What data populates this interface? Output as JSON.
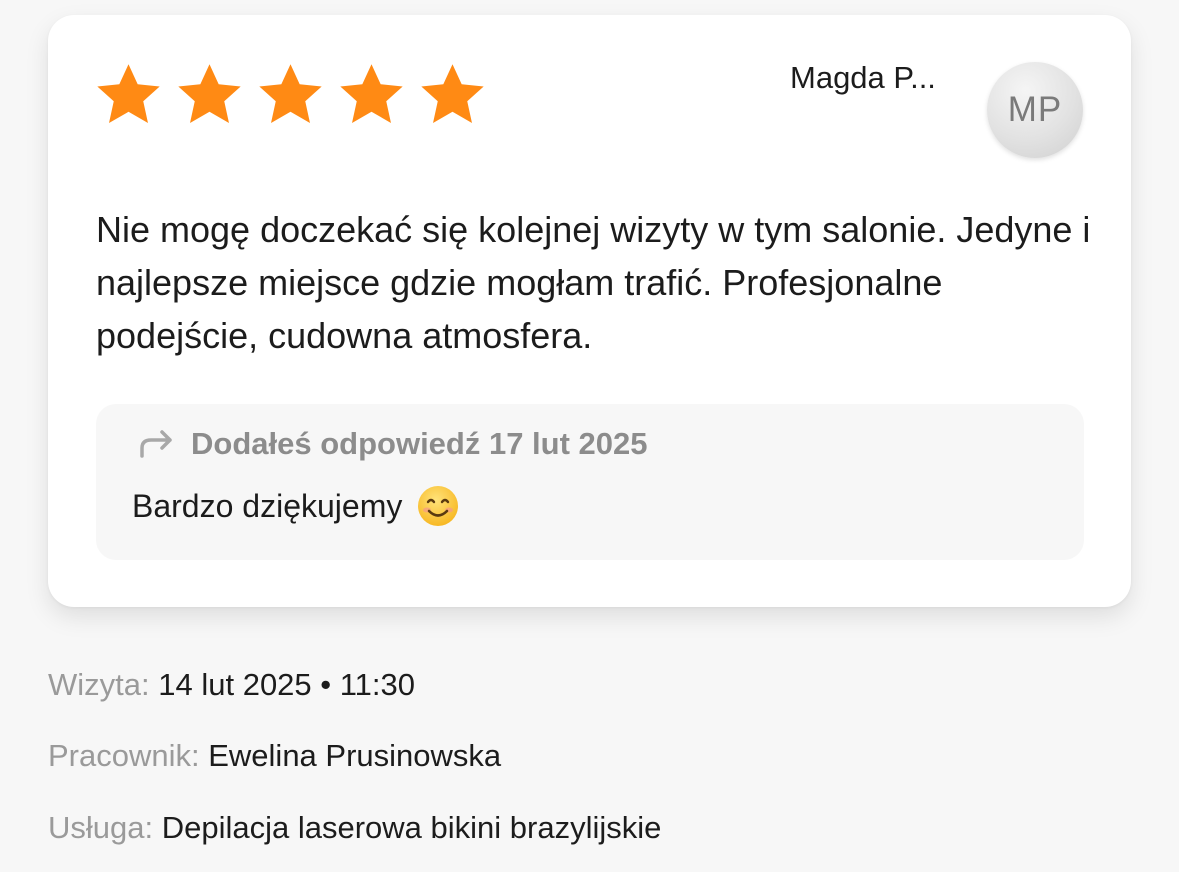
{
  "review": {
    "rating": 5,
    "max_rating": 5,
    "author_name": "Magda P...",
    "author_initials": "MP",
    "text": "Nie mogę doczekać się kolejnej wizyty w tym salonie. Jedyne i najlepsze miejsce gdzie mogłam trafić. Profesjonalne podejście, cudowna atmosfera.",
    "star_color": "#ff8a14"
  },
  "reply": {
    "header": "Dodałeś odpowiedź 17 lut 2025",
    "text": "Bardzo dziękujemy",
    "icon": "reply-arrow-icon",
    "emoji": "smiling-face-icon"
  },
  "details": {
    "visit_label": "Wizyta:",
    "visit_value": "14 lut 2025 • 11:30",
    "employee_label": "Pracownik:",
    "employee_value": "Ewelina Prusinowska",
    "service_label": "Usługa:",
    "service_value": "Depilacja laserowa bikini brazylijskie"
  }
}
